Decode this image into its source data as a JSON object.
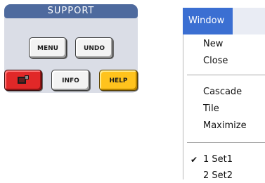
{
  "support": {
    "title": "SUPPORT",
    "buttons": {
      "menu": "MENU",
      "undo": "UNDO",
      "info": "INFO",
      "help": "HELP"
    },
    "colors": {
      "panel": "#dadde6",
      "title_bar": "#4e6a9e",
      "ext_button": "#e12828",
      "help_button": "#ffc31d"
    }
  },
  "window_menu": {
    "title": "Window",
    "items": [
      {
        "label": "New"
      },
      {
        "label": "Close"
      },
      {
        "label": "Cascade"
      },
      {
        "label": "Tile"
      },
      {
        "label": "Maximize"
      },
      {
        "label": "1 Set1",
        "checked": true
      },
      {
        "label": "2 Set2"
      }
    ],
    "check_icon": "✔",
    "colors": {
      "header": "#3b6fd2"
    }
  }
}
